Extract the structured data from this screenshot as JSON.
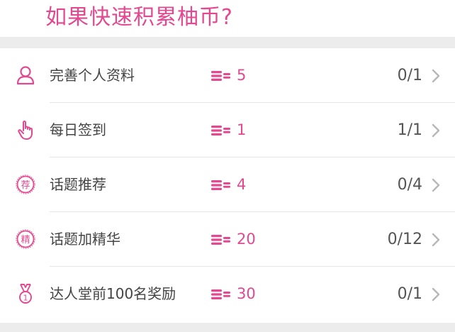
{
  "theme": {
    "accent": "#e4488e"
  },
  "header": {
    "title": "如果快速积累柚币?"
  },
  "tasks": [
    {
      "label": "完善个人资料",
      "reward": "5",
      "progress": "0/1",
      "icon": "person-icon"
    },
    {
      "label": "每日签到",
      "reward": "1",
      "progress": "1/1",
      "icon": "pointing-hand-icon"
    },
    {
      "label": "话题推荐",
      "reward": "4",
      "progress": "0/4",
      "icon": "recommend-badge-icon",
      "badge": "荐"
    },
    {
      "label": "话题加精华",
      "reward": "20",
      "progress": "0/12",
      "icon": "essence-badge-icon",
      "badge": "精"
    },
    {
      "label": "达人堂前100名奖励",
      "reward": "30",
      "progress": "0/1",
      "icon": "medal-icon",
      "badge": "1"
    }
  ]
}
